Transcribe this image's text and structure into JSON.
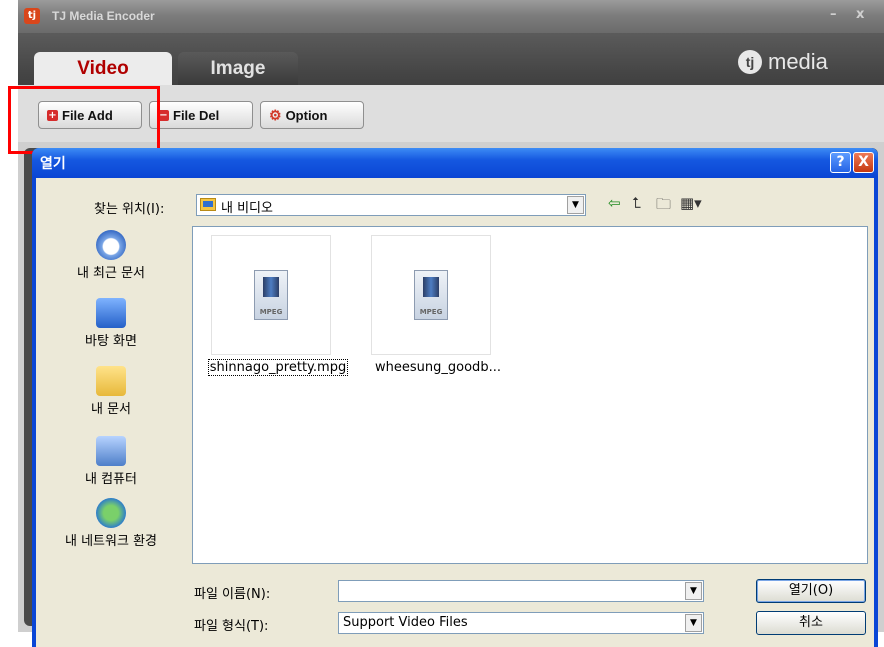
{
  "app": {
    "title": "TJ Media Encoder",
    "logo_glyph": "tj",
    "window_controls": {
      "minimize": "–",
      "close": "x"
    },
    "tabs": [
      {
        "label": "Video",
        "active": true
      },
      {
        "label": "Image",
        "active": false
      }
    ],
    "brand": {
      "mark": "tj",
      "text": "media"
    },
    "toolbar": {
      "file_add": "File Add",
      "file_del": "File Del",
      "option": "Option"
    },
    "colors": {
      "accent_red": "#d62c2c",
      "highlight": "#ff0000"
    }
  },
  "dialog": {
    "title": "열기",
    "help_glyph": "?",
    "close_glyph": "X",
    "look_in_label": "찾는 위치(I):",
    "look_in_value": "내 비디오",
    "places": [
      {
        "label": "내 최근 문서",
        "icon": "recent-documents-icon"
      },
      {
        "label": "바탕 화면",
        "icon": "desktop-icon"
      },
      {
        "label": "내 문서",
        "icon": "my-documents-icon"
      },
      {
        "label": "내 컴퓨터",
        "icon": "my-computer-icon"
      },
      {
        "label": "내 네트워크 환경",
        "icon": "network-places-icon"
      }
    ],
    "files": [
      {
        "name": "shinnago_pretty.mpg",
        "type_badge": "MPEG",
        "selected": true
      },
      {
        "name": "wheesung_goodb...",
        "type_badge": "MPEG",
        "selected": false
      }
    ],
    "file_name_label": "파일 이름(N):",
    "file_name_value": "",
    "file_type_label": "파일 형식(T):",
    "file_type_value": "Support Video Files",
    "open_button": "열기(O)",
    "cancel_button": "취소"
  }
}
